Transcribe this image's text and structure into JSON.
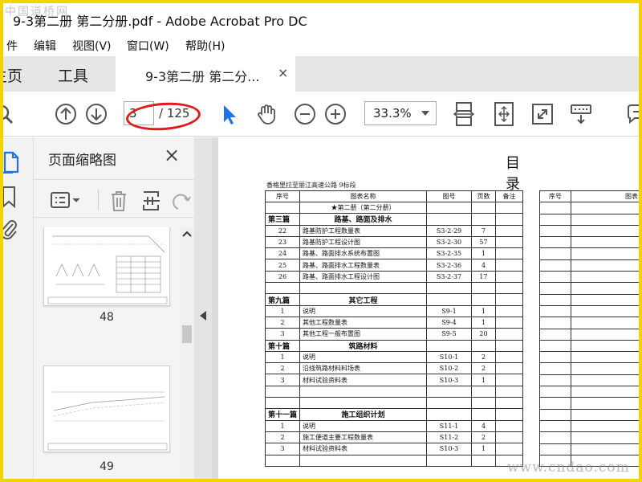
{
  "window": {
    "title": "9-3第二册  第二分册.pdf - Adobe Acrobat Pro DC"
  },
  "watermarks": {
    "top": "中国道桥网",
    "bottom": "www.cndao.com"
  },
  "menu": [
    "文件",
    "编辑(E)",
    "视图(V)",
    "窗口(W)",
    "帮助(H)"
  ],
  "menu_visible": [
    "件",
    "编辑",
    "视图(V)",
    "窗口(W)",
    "帮助(H)"
  ],
  "nav": {
    "home": "主页",
    "home_visible": "主页",
    "tools": "工具"
  },
  "tab": {
    "label": "9-3第二册  第二分...",
    "close": "×"
  },
  "toolbar": {
    "current_page": "3",
    "total_pages": "/ 125",
    "zoom": "33.3%"
  },
  "colors": {
    "accent": "#1e73e8",
    "highlight_ring": "#e01b1b",
    "frame": "#f2d400"
  },
  "thumbnails": {
    "panel_title": "页面缩略图",
    "close": "×",
    "pages": [
      {
        "number": "48"
      },
      {
        "number": "49"
      }
    ]
  },
  "document": {
    "heading": "目 录",
    "project": "香格里拉至丽江高速公路  9标段",
    "columns": [
      "序号",
      "图表名称",
      "图号",
      "页数",
      "备注"
    ],
    "right_columns": [
      "序号",
      "图表名称"
    ],
    "rows": [
      {
        "type": "title",
        "name": "★第二册（第二分册）"
      },
      {
        "type": "section",
        "no": "第三篇",
        "name": "路基、路面及排水"
      },
      {
        "no": "22",
        "name": "路基防护工程数量表",
        "fig": "S3-2-29",
        "pages": "7"
      },
      {
        "no": "23",
        "name": "路基防护工程设计图",
        "fig": "S3-2-30",
        "pages": "57"
      },
      {
        "no": "24",
        "name": "路基、路面排水系统布置图",
        "fig": "S3-2-35",
        "pages": "1"
      },
      {
        "no": "25",
        "name": "路基、路面排水工程数量表",
        "fig": "S3-2-36",
        "pages": "4"
      },
      {
        "no": "26",
        "name": "路基、路面排水工程设计图",
        "fig": "S3-2-37",
        "pages": "17"
      },
      {
        "type": "blank"
      },
      {
        "type": "section",
        "no": "第九篇",
        "name": "其它工程"
      },
      {
        "no": "1",
        "name": "说明",
        "fig": "S9-1",
        "pages": "1"
      },
      {
        "no": "2",
        "name": "其他工程数量表",
        "fig": "S9-4",
        "pages": "1"
      },
      {
        "no": "3",
        "name": "其他工程一般布置图",
        "fig": "S9-5",
        "pages": "20"
      },
      {
        "type": "section",
        "no": "第十篇",
        "name": "筑路材料"
      },
      {
        "no": "1",
        "name": "说明",
        "fig": "S10-1",
        "pages": "2"
      },
      {
        "no": "2",
        "name": "沿线筑路材料料场表",
        "fig": "S10-2",
        "pages": "2"
      },
      {
        "no": "3",
        "name": "材料试验资料表",
        "fig": "S10-3",
        "pages": "1"
      },
      {
        "type": "blank"
      },
      {
        "type": "blank"
      },
      {
        "type": "section",
        "no": "第十一篇",
        "name": "施工组织计划"
      },
      {
        "no": "1",
        "name": "说明",
        "fig": "S11-1",
        "pages": "4"
      },
      {
        "no": "2",
        "name": "施工便道主要工程数量表",
        "fig": "S11-2",
        "pages": "2"
      },
      {
        "no": "3",
        "name": "材料试验资料表",
        "fig": "S10-3",
        "pages": "1"
      },
      {
        "type": "blank"
      }
    ]
  }
}
